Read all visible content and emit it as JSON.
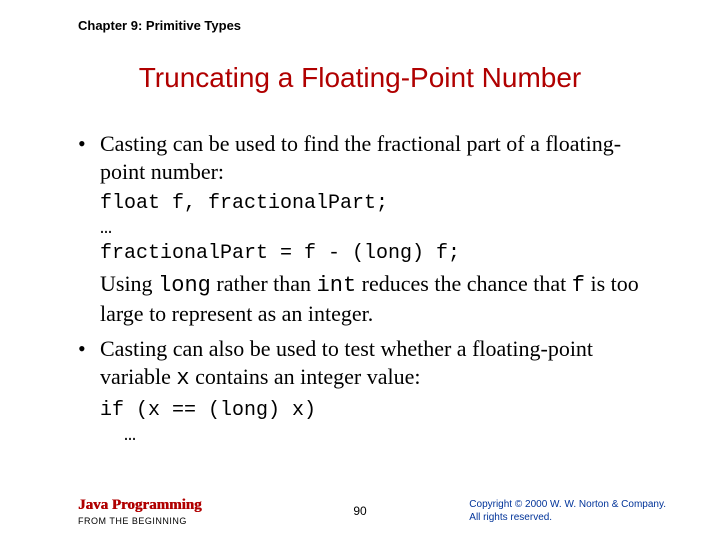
{
  "chapter": "Chapter 9: Primitive Types",
  "title": "Truncating a Floating-Point Number",
  "bullet1": "Casting can be used to find the fractional part of a floating-point number:",
  "code1": "float f, fractionalPart;\n…\nfractionalPart = f - (long) f;",
  "sub1_a": "Using ",
  "sub1_b": "long",
  "sub1_c": " rather than ",
  "sub1_d": "int",
  "sub1_e": " reduces the chance that ",
  "sub1_f": "f",
  "sub1_g": " is too large to represent as an integer.",
  "bullet2_a": "Casting can also be used to test whether a floating-point variable ",
  "bullet2_b": "x",
  "bullet2_c": " contains an integer value:",
  "code2": "if (x == (long) x)\n  …",
  "footer": {
    "book": "Java Programming",
    "sub": "FROM THE BEGINNING",
    "page": "90",
    "copy1": "Copyright © 2000 W. W. Norton & Company.",
    "copy2": "All rights reserved."
  }
}
